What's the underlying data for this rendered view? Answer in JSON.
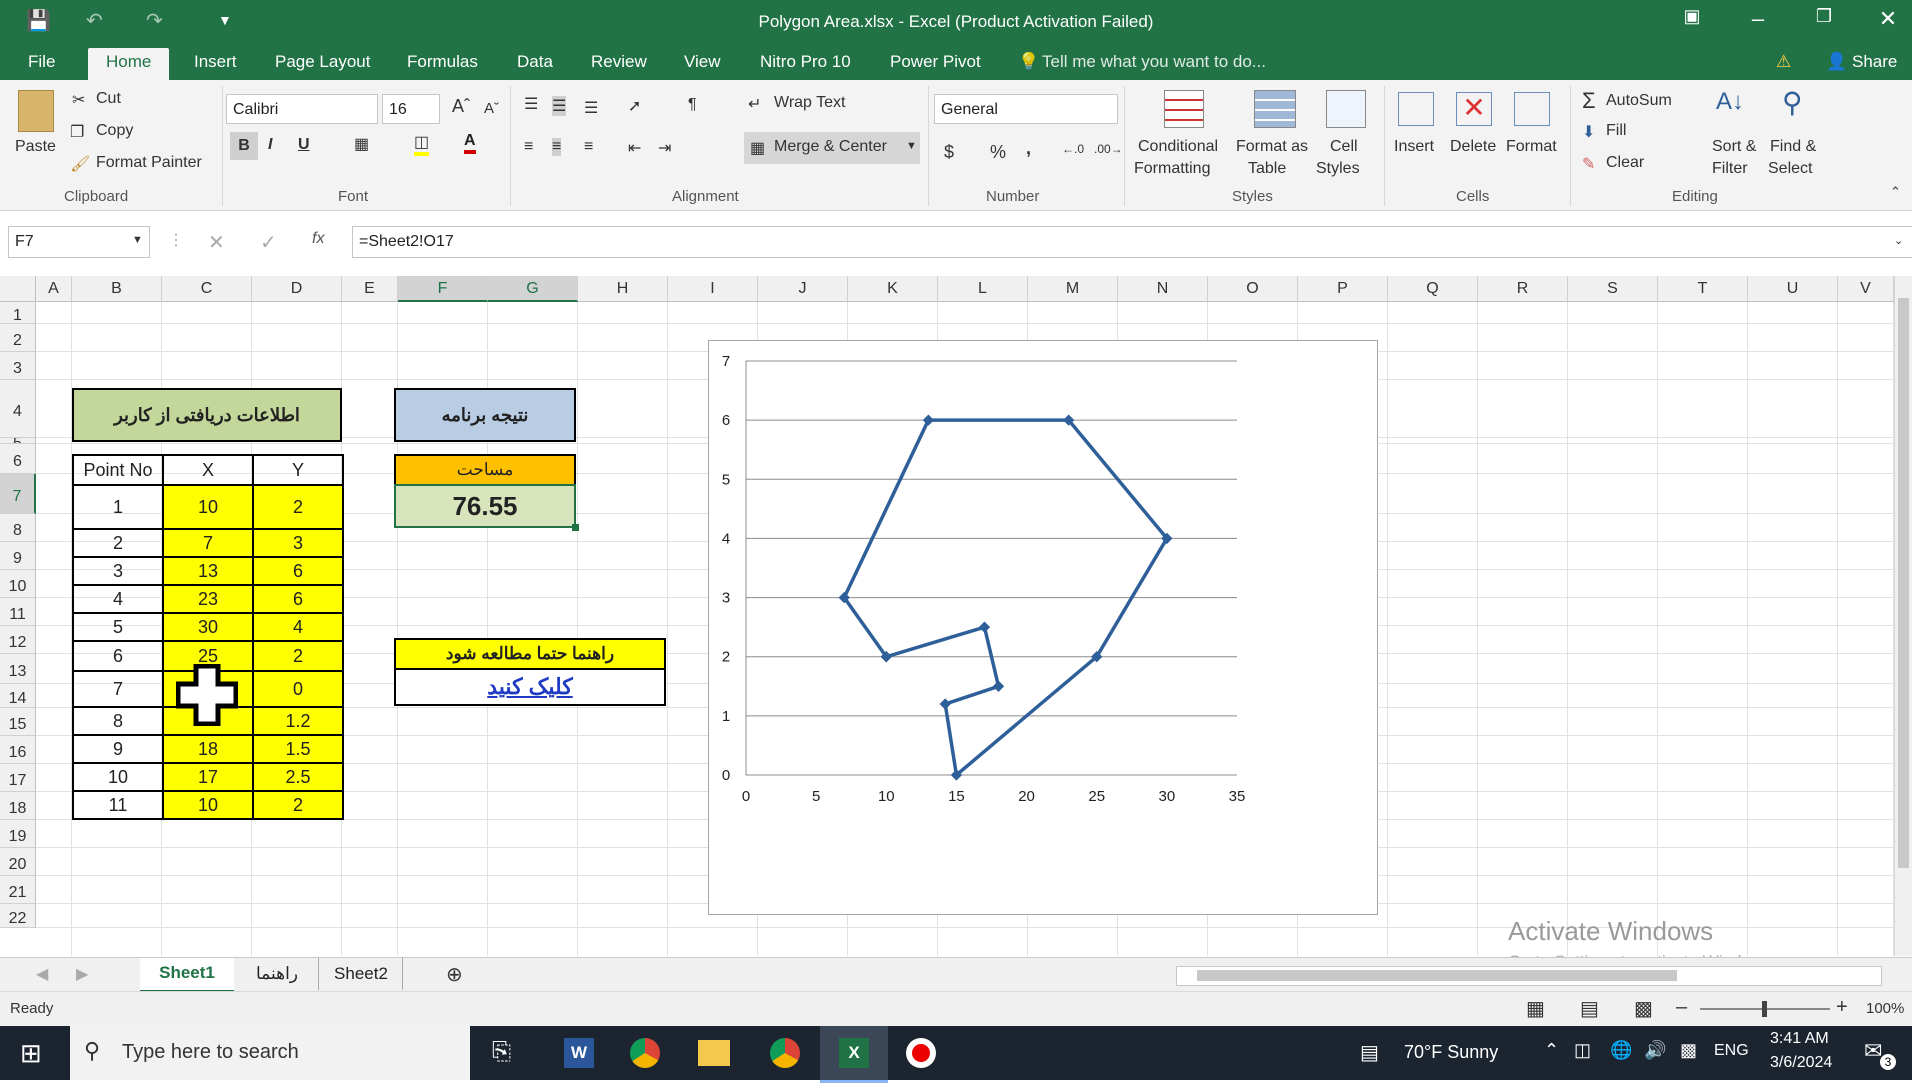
{
  "window": {
    "title": "Polygon Area.xlsx - Excel (Product Activation Failed)"
  },
  "tabs": [
    "File",
    "Home",
    "Insert",
    "Page Layout",
    "Formulas",
    "Data",
    "Review",
    "View",
    "Nitro Pro 10",
    "Power Pivot"
  ],
  "tell_me": "Tell me what you want to do...",
  "share": "Share",
  "ribbon": {
    "clipboard": {
      "paste": "Paste",
      "cut": "Cut",
      "copy": "Copy",
      "format_painter": "Format Painter",
      "group": "Clipboard"
    },
    "font": {
      "name": "Calibri",
      "size": "16",
      "bold": "B",
      "italic": "I",
      "underline": "U",
      "group": "Font"
    },
    "alignment": {
      "wrap": "Wrap Text",
      "merge": "Merge & Center",
      "group": "Alignment"
    },
    "number": {
      "format": "General",
      "currency": "$",
      "percent": "%",
      "comma": ",",
      "group": "Number"
    },
    "styles": {
      "conditional_1": "Conditional",
      "conditional_2": "Formatting",
      "table_1": "Format as",
      "table_2": "Table",
      "cell_1": "Cell",
      "cell_2": "Styles",
      "group": "Styles"
    },
    "cells": {
      "insert": "Insert",
      "delete": "Delete",
      "format": "Format",
      "group": "Cells"
    },
    "editing": {
      "autosum": "AutoSum",
      "fill": "Fill",
      "clear": "Clear",
      "sort_1": "Sort &",
      "sort_2": "Filter",
      "find_1": "Find &",
      "find_2": "Select",
      "group": "Editing"
    }
  },
  "formula_bar": {
    "name_box": "F7",
    "fx": "fx",
    "formula": "=Sheet2!O17"
  },
  "columns": [
    "A",
    "B",
    "C",
    "D",
    "E",
    "F",
    "G",
    "H",
    "I",
    "J",
    "K",
    "L",
    "M",
    "N",
    "O",
    "P",
    "Q",
    "R",
    "S",
    "T",
    "U",
    "V"
  ],
  "rows": [
    "1",
    "2",
    "3",
    "4",
    "5",
    "6",
    "7",
    "8",
    "9",
    "10",
    "11",
    "12",
    "13",
    "14",
    "15",
    "16",
    "17",
    "18",
    "19",
    "20",
    "21",
    "22"
  ],
  "sheet": {
    "input_title": "اطلاعات دریافتی از کاربر",
    "result_title": "نتیجه برنامه",
    "area_label": "مساحت",
    "area_value": "76.55",
    "help_title": "راهنما حتما مطالعه شود",
    "help_link": "کلیک کنید",
    "headers": [
      "Point No",
      "X",
      "Y"
    ],
    "points": [
      [
        "1",
        "10",
        "2"
      ],
      [
        "2",
        "7",
        "3"
      ],
      [
        "3",
        "13",
        "6"
      ],
      [
        "4",
        "23",
        "6"
      ],
      [
        "5",
        "30",
        "4"
      ],
      [
        "6",
        "25",
        "2"
      ],
      [
        "7",
        "",
        "0"
      ],
      [
        "8",
        "",
        "1.2"
      ],
      [
        "9",
        "18",
        "1.5"
      ],
      [
        "10",
        "17",
        "2.5"
      ],
      [
        "11",
        "10",
        "2"
      ]
    ]
  },
  "chart_data": {
    "type": "scatter",
    "series": [
      {
        "x": [
          10,
          7,
          13,
          23,
          30,
          25,
          15,
          14.2,
          18,
          17,
          10
        ],
        "y": [
          2,
          3,
          6,
          6,
          4,
          2,
          0,
          1.2,
          1.5,
          2.5,
          2
        ]
      }
    ],
    "xlim": [
      0,
      35
    ],
    "ylim": [
      0,
      7
    ],
    "xticks": [
      "0",
      "5",
      "10",
      "15",
      "20",
      "25",
      "30",
      "35"
    ],
    "yticks": [
      "0",
      "1",
      "2",
      "3",
      "4",
      "5",
      "6",
      "7"
    ],
    "grid": "horizontal",
    "color": "#2e5f99"
  },
  "sheet_tabs": [
    "Sheet1",
    "راهنما",
    "Sheet2"
  ],
  "status": {
    "ready": "Ready",
    "zoom": "100%"
  },
  "watermark": {
    "line1": "Activate Windows",
    "line2": "Go to Settings to activate Windows."
  },
  "taskbar": {
    "search": "Type here to search",
    "weather": "70°F  Sunny",
    "lang": "ENG",
    "time": "3:41 AM",
    "date": "3/6/2024",
    "notif": "3"
  }
}
